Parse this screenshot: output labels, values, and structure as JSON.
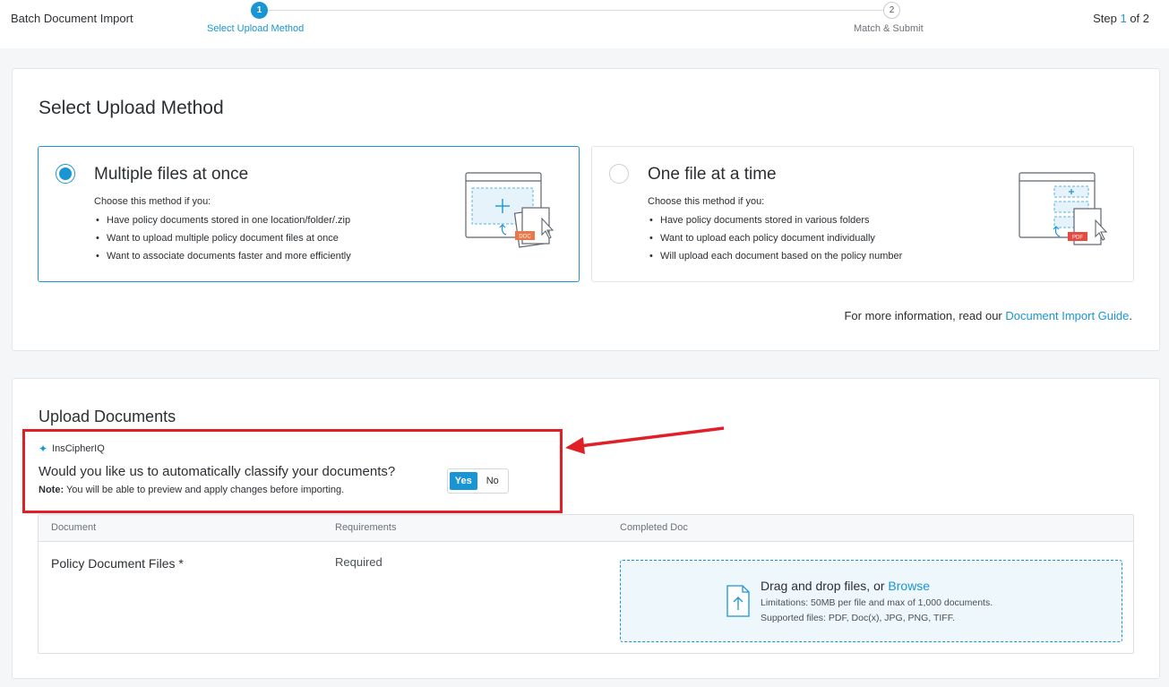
{
  "header": {
    "app_title": "Batch Document Import",
    "steps": [
      {
        "number": "1",
        "label": "Select Upload Method"
      },
      {
        "number": "2",
        "label": "Match & Submit"
      }
    ],
    "counter_prefix": "Step ",
    "counter_current": "1",
    "counter_suffix": " of 2"
  },
  "method": {
    "title": "Select Upload Method",
    "options": [
      {
        "title": "Multiple files at once",
        "intro": "Choose this method if you:",
        "bullets": [
          "Have policy documents stored in one location/folder/.zip",
          "Want to upload multiple policy document files at once",
          "Want to associate documents faster and more efficiently"
        ],
        "badge": "DOC",
        "selected": true
      },
      {
        "title": "One file at a time",
        "intro": "Choose this method if you:",
        "bullets": [
          "Have policy documents stored in various folders",
          "Want to upload each policy document individually",
          "Will upload each document based on the policy number"
        ],
        "badge": "PDF",
        "selected": false
      }
    ],
    "more_info_text": "For more information, read our ",
    "more_info_link": "Document Import Guide",
    "more_info_end": "."
  },
  "upload": {
    "title": "Upload Documents",
    "ai_label": "InsCipherIQ",
    "question": "Would you like us to automatically classify your documents?",
    "note_label": "Note:",
    "note_text": " You will be able to preview and apply changes before importing.",
    "toggle_yes": "Yes",
    "toggle_no": "No",
    "table": {
      "headers": [
        "Document",
        "Requirements",
        "Completed Doc"
      ],
      "row": {
        "document": "Policy Document Files *",
        "requirement": "Required"
      }
    },
    "dropzone": {
      "title": "Drag and drop files, or ",
      "browse": "Browse",
      "limitations": "Limitations: 50MB per file and max of 1,000 documents.",
      "supported": "Supported files: PDF, Doc(x), JPG, PNG, TIFF."
    }
  },
  "colors": {
    "accent": "#1a95d3",
    "highlight": "#e01f26",
    "doc_badge": "#e8774a",
    "pdf_badge": "#e94a3f"
  }
}
